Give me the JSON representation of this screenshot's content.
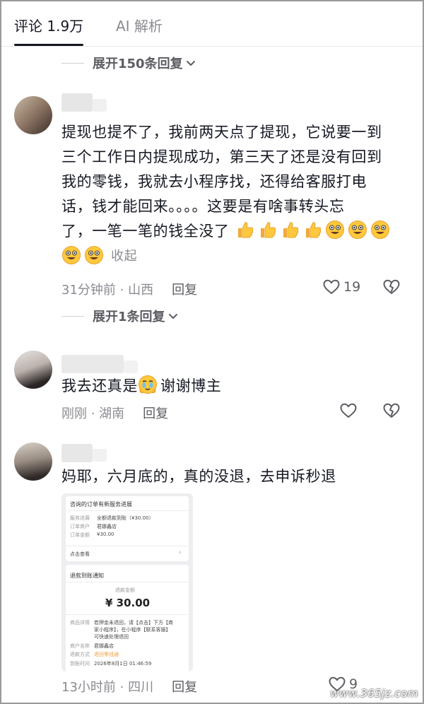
{
  "tabs": {
    "comments": "评论 1.9万",
    "ai": "AI 解析"
  },
  "expand_top": {
    "label": "展开150条回复"
  },
  "comments": [
    {
      "text_lines": [
        "提现也提不了，我前两天点了提现，它说要一到",
        "三个工作日内提现成功，第三天了还是没有回到",
        "我的零钱，我就去小程序找，还得给客服打电",
        "话，钱才能回来。。。。这要是有啥事转头忘",
        "了，一笔一笔的钱全没了"
      ],
      "collapse_label": "收起",
      "meta": "31分钟前 · 山西",
      "reply_label": "回复",
      "likes": "19",
      "expand_label": "展开1条回复"
    },
    {
      "text_before": "我去还真是",
      "text_after": "谢谢博主",
      "meta": "刚刚 · 湖南",
      "reply_label": "回复"
    },
    {
      "text": "妈耶，六月底的，真的没退，去申诉秒退",
      "meta": "13小时前 · 四川",
      "reply_label": "回复",
      "likes": "9"
    }
  ],
  "card": {
    "title": "咨询的订单有新服务进展",
    "rows1": [
      {
        "k": "服务进展",
        "v": "全额退款到账（¥30.00）"
      },
      {
        "k": "订单商户",
        "v": "君娜鑫店"
      },
      {
        "k": "订单金额",
        "v": "¥30.00"
      }
    ],
    "view_label": "点击查看",
    "refund_title": "退款到账通知",
    "refund_amount_label": "退款金额",
    "refund_amount": "¥ 30.00",
    "rows2": [
      {
        "k": "商品详情",
        "v": "若押金未退回，请【点击】下方【商"
      },
      {
        "k": "",
        "v": "家小程序】，在小程序【联系客服】"
      },
      {
        "k": "",
        "v": "可快速处理退回"
      },
      {
        "k": "商户名称",
        "v": "君娜鑫店"
      },
      {
        "k": "退款方式",
        "v": "退回零钱通"
      },
      {
        "k": "到账时间",
        "v": "2026年8月1日 01:46:59"
      }
    ]
  },
  "watermark": "www.365jz.com",
  "colors": {
    "text": "#161823",
    "secondary": "#8a8b91",
    "emoji": "#ffc83d"
  }
}
